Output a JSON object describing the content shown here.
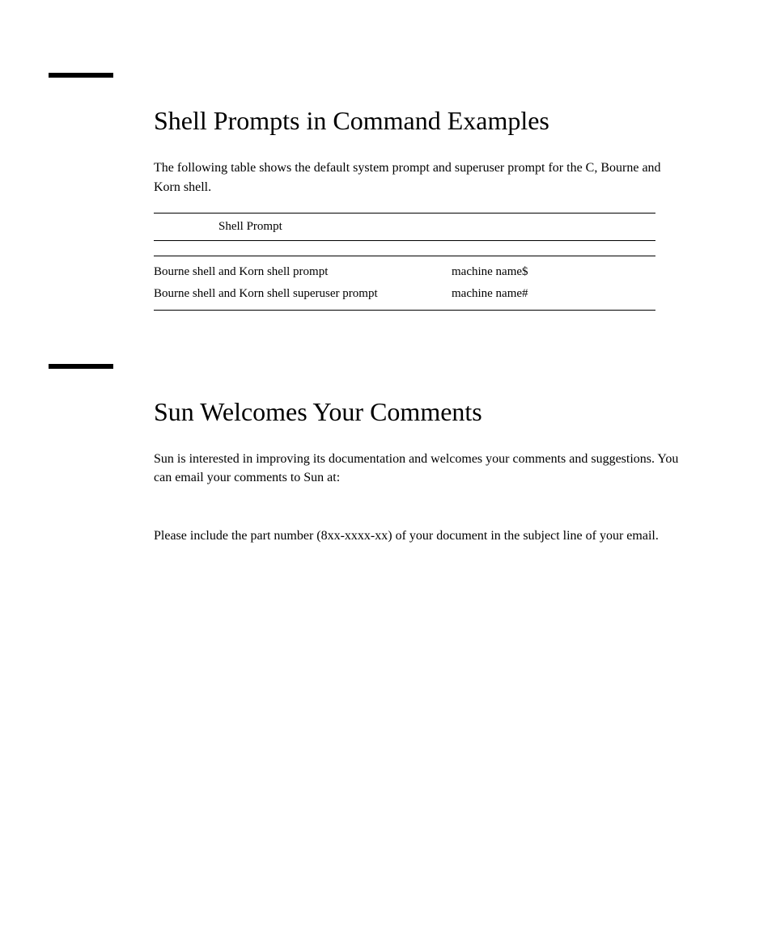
{
  "section1": {
    "heading": "Shell Prompts in Command Examples",
    "intro": "The following table shows the default system prompt and superuser prompt for the C, Bourne and Korn shell.",
    "table": {
      "header": "Shell Prompt",
      "rows": [
        {
          "shell": "Bourne shell and Korn shell prompt",
          "prompt": "machine name$"
        },
        {
          "shell": "Bourne shell and Korn shell superuser prompt",
          "prompt": "machine name#"
        }
      ]
    }
  },
  "section2": {
    "heading": "Sun Welcomes Your Comments",
    "p1": "Sun is interested in improving its documentation and welcomes your comments and suggestions. You can email your comments to Sun at:",
    "p2": "Please include the part number (8xx-xxxx-xx) of your document in the subject line of your email."
  }
}
